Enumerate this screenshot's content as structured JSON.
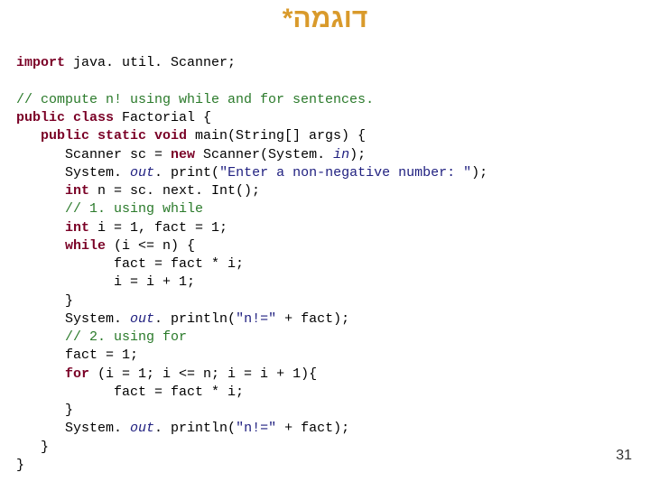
{
  "title": "דוגמה*",
  "page_number": "31",
  "code": {
    "l01a": "import",
    "l01b": " java. util. Scanner;",
    "blank1": "",
    "l02": "// compute n! using while and for sentences.",
    "l03a": "public class",
    "l03b": " Factorial {",
    "l04a": "   public static void",
    "l04b": " main(String[] args) {",
    "l05a": "      Scanner sc = ",
    "l05b": "new",
    "l05c": " Scanner(System. ",
    "l05d": "in",
    "l05e": ");",
    "l06a": "      System. ",
    "l06b": "out",
    "l06c": ". print(",
    "l06d": "\"Enter a non-negative number: \"",
    "l06e": ");",
    "l07a": "      ",
    "l07b": "int",
    "l07c": " n = sc. next. Int();",
    "l08": "      // 1. using while",
    "l09a": "      ",
    "l09b": "int",
    "l09c": " i = 1, fact = 1;",
    "l10a": "      ",
    "l10b": "while",
    "l10c": " (i <= n) {",
    "l11": "            fact = fact * i;",
    "l12": "            i = i + 1;",
    "l13": "      }",
    "l14a": "      System. ",
    "l14b": "out",
    "l14c": ". println(",
    "l14d": "\"n!=\"",
    "l14e": " + fact);",
    "l15": "      // 2. using for",
    "l16": "      fact = 1;",
    "l17a": "      ",
    "l17b": "for",
    "l17c": " (i = 1; i <= n; i = i + 1){",
    "l18": "            fact = fact * i;",
    "l19": "      }",
    "l20a": "      System. ",
    "l20b": "out",
    "l20c": ". println(",
    "l20d": "\"n!=\"",
    "l20e": " + fact);",
    "l21": "   }",
    "l22": "}"
  }
}
